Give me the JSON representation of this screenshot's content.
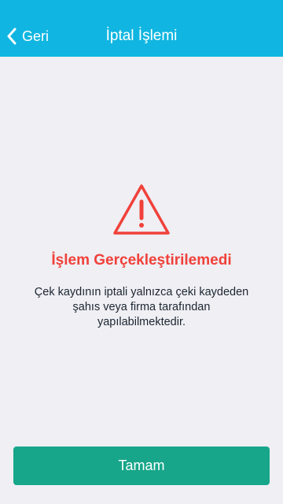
{
  "header": {
    "back_label": "Geri",
    "back_icon": "chevron-left-icon",
    "title": "İptal İşlemi"
  },
  "alert": {
    "icon": "warning-triangle-icon",
    "title": "İşlem Gerçekleştirilemedi",
    "message": "Çek kaydının iptali yalnızca çeki kaydeden şahıs veya firma tarafından yapılabilmektedir."
  },
  "actions": {
    "confirm_label": "Tamam"
  },
  "colors": {
    "header_background": "#10b6e1",
    "page_background": "#efeff4",
    "error": "#f0413a",
    "button": "#17a68a"
  }
}
